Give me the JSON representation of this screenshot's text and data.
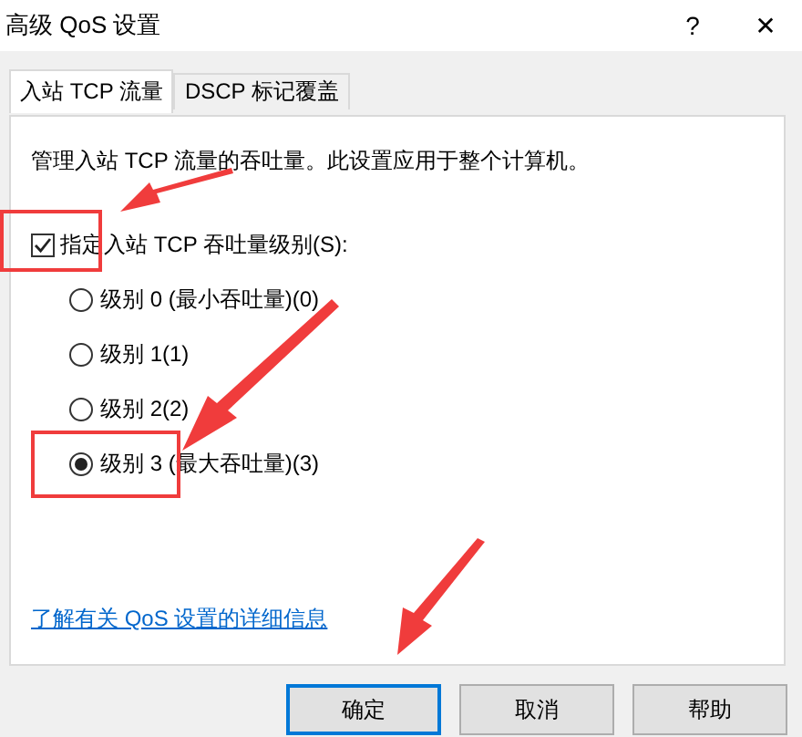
{
  "window": {
    "title": "高级 QoS 设置",
    "help_glyph": "?",
    "close_glyph": "✕"
  },
  "tabs": [
    {
      "label": "入站 TCP 流量",
      "selected": true
    },
    {
      "label": "DSCP 标记覆盖",
      "selected": false
    }
  ],
  "description": "管理入站 TCP 流量的吞吐量。此设置应用于整个计算机。",
  "throughput_checkbox": {
    "label": "指定入站 TCP 吞吐量级别(S):",
    "checked": true
  },
  "levels": [
    {
      "label": "级别 0 (最小吞吐量)(0)",
      "selected": false
    },
    {
      "label": "级别 1(1)",
      "selected": false
    },
    {
      "label": "级别 2(2)",
      "selected": false
    },
    {
      "label": "级别 3 (最大吞吐量)(3)",
      "selected": true
    }
  ],
  "link": "了解有关 QoS 设置的详细信息",
  "buttons": [
    {
      "label": "确定",
      "default": true
    },
    {
      "label": "取消",
      "default": false
    },
    {
      "label": "帮助",
      "default": false
    }
  ]
}
